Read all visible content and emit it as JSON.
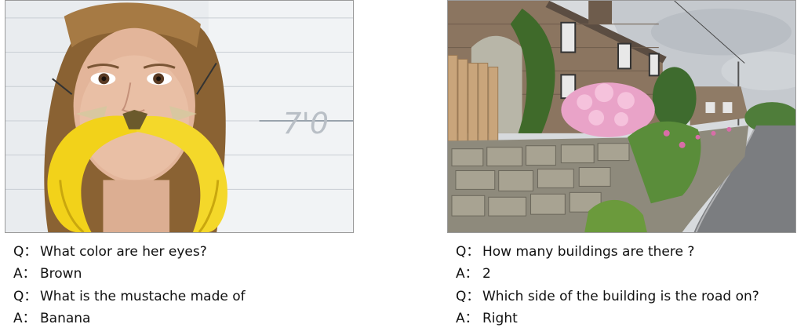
{
  "left_panel": {
    "image": "woman with banana mustache against height chart wall",
    "qa": [
      {
        "prefix": "Q：",
        "text": "What color are her eyes?"
      },
      {
        "prefix": "A：",
        "text": "Brown"
      },
      {
        "prefix": "Q：",
        "text": "What is the mustache made of"
      },
      {
        "prefix": "A：",
        "text": "Banana"
      }
    ],
    "wall_marking": "7'0"
  },
  "right_panel": {
    "image": "stone cottages with stone wall, flowers and road",
    "qa": [
      {
        "prefix": "Q：",
        "text": "How many buildings are there ?"
      },
      {
        "prefix": "A：",
        "text": "2"
      },
      {
        "prefix": "Q：",
        "text": "Which side of the building is the road on?"
      },
      {
        "prefix": "A：",
        "text": "Right"
      }
    ]
  }
}
